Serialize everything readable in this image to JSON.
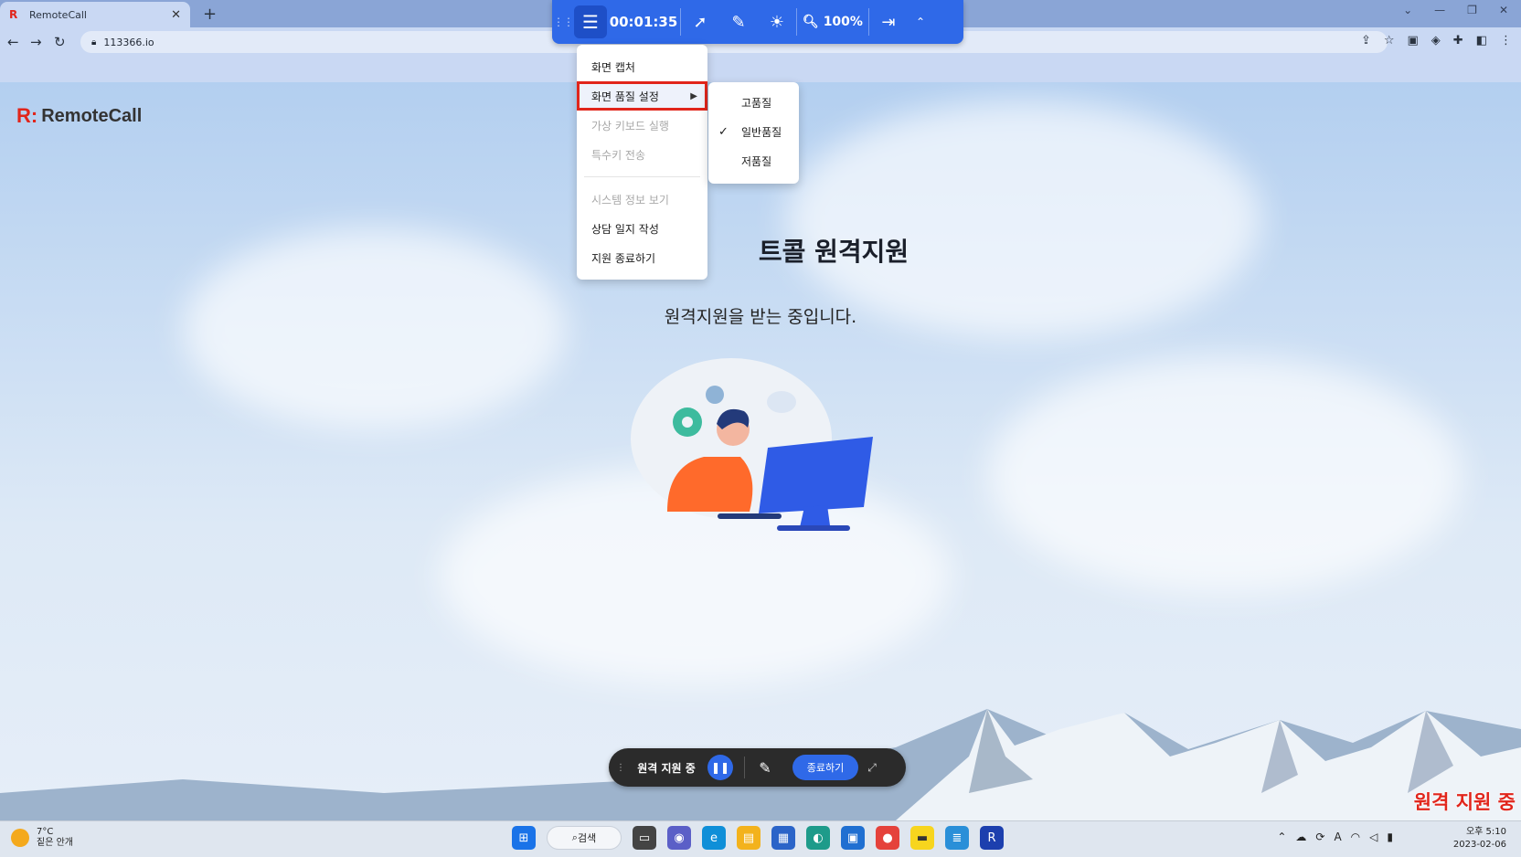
{
  "browser": {
    "tab_title": "RemoteCall",
    "tab_favicon": "R",
    "new_tab": "+",
    "url": "113366.io"
  },
  "page": {
    "logo_mark": "R:",
    "logo_text": "RemoteCall",
    "title": "트콜 원격지원",
    "subtitle": "원격지원을 받는 중입니다.",
    "overlay_badge": "원격 지원 중"
  },
  "toolbar": {
    "timer": "00:01:35",
    "zoom": "100%",
    "accent": "#2f69e8"
  },
  "menu": {
    "items": [
      {
        "label": "화면 캡처",
        "state": "enabled"
      },
      {
        "label": "화면 품질 설정",
        "state": "highlighted"
      },
      {
        "label": "가상 키보드 실행",
        "state": "disabled"
      },
      {
        "label": "특수키 전송",
        "state": "disabled"
      },
      {
        "label": "시스템 정보 보기",
        "state": "disabled"
      },
      {
        "label": "상담 일지 작성",
        "state": "enabled"
      },
      {
        "label": "지원 종료하기",
        "state": "enabled"
      }
    ]
  },
  "quality_submenu": {
    "items": [
      {
        "label": "고품질",
        "checked": false
      },
      {
        "label": "일반품질",
        "checked": true
      },
      {
        "label": "저품질",
        "checked": false
      }
    ]
  },
  "status_bar": {
    "label": "원격 지원 중",
    "end_button": "종료하기"
  },
  "taskbar": {
    "temperature": "7°C",
    "weather_desc": "짙은 안개",
    "search_label": "검색",
    "time": "오후 5:10",
    "date": "2023-02-06"
  }
}
